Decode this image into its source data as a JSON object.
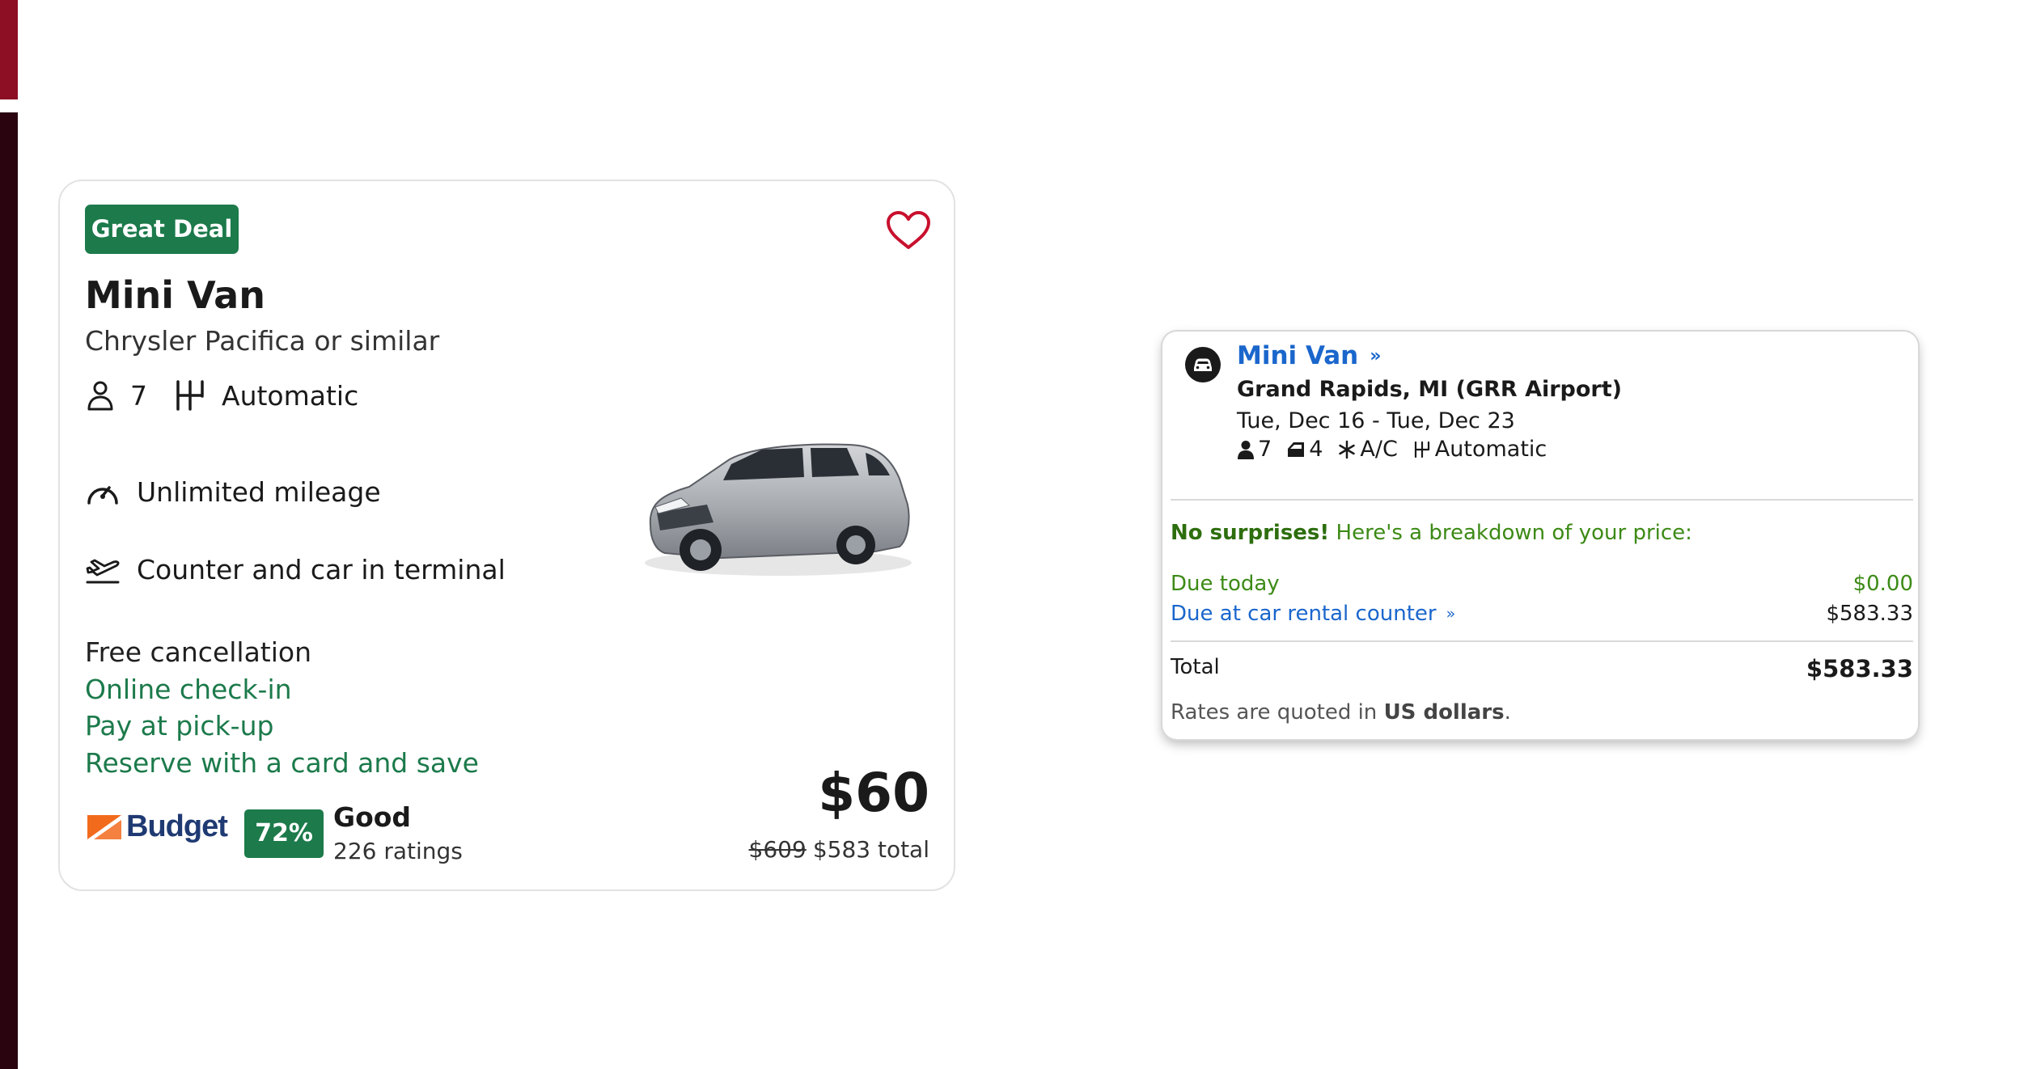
{
  "card": {
    "badge": "Great Deal",
    "title": "Mini Van",
    "subtitle": "Chrysler Pacifica or similar",
    "seats": "7",
    "transmission": "Automatic",
    "features": [
      "Unlimited mileage",
      "Counter and car in terminal"
    ],
    "perks": [
      "Free cancellation",
      "Online check-in",
      "Pay at pick-up",
      "Reserve with a card and save"
    ],
    "brand": "Budget",
    "rating_percent": "72%",
    "rating_label": "Good",
    "rating_count": "226 ratings",
    "price": "$60",
    "old_total": "$609",
    "new_total": "$583 total",
    "favorited": false,
    "colors": {
      "badge": "#1c7a4b",
      "heart": "#c8102e",
      "perk_green": "#1c7a4b"
    }
  },
  "panel": {
    "title": "Mini Van",
    "location": "Grand Rapids, MI (GRR Airport)",
    "dates": "Tue, Dec 16 - Tue, Dec 23",
    "seats": "7",
    "bags": "4",
    "ac": "A/C",
    "transmission": "Automatic",
    "note_strong": "No surprises!",
    "note_text": "Here's a breakdown of your price:",
    "due_today_label": "Due today",
    "due_today_value": "$0.00",
    "due_counter_label": "Due at car rental counter",
    "due_counter_value": "$583.33",
    "total_label": "Total",
    "total_value": "$583.33",
    "rates_prefix": "Rates are quoted in",
    "rates_currency": "US dollars",
    "rates_suffix": ".",
    "colors": {
      "link": "#1a66cc",
      "green": "#3c8a16"
    }
  }
}
